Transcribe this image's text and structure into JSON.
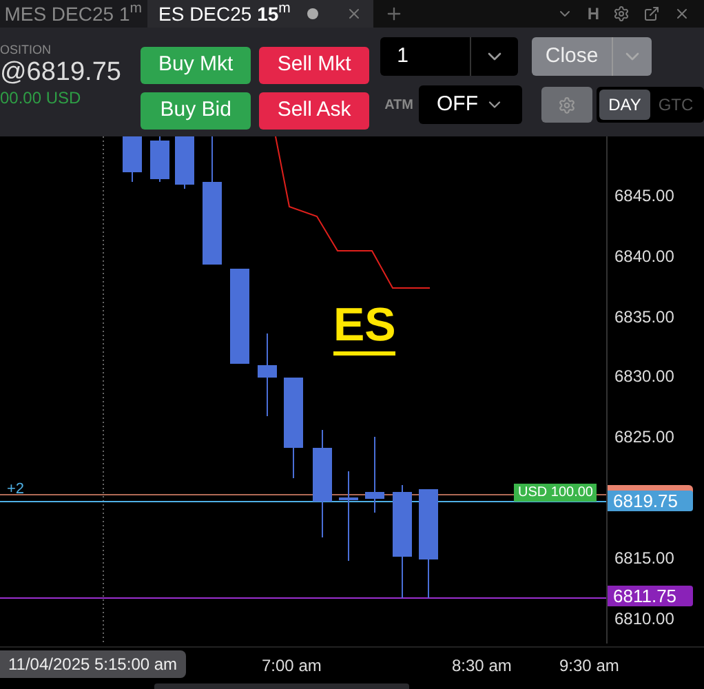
{
  "tabs": [
    {
      "label": "MES DEC25 1$^{m}$",
      "selected": false,
      "dot": false
    },
    {
      "label": "ES DEC25 **15**$^{m}$",
      "selected": true,
      "dot": true
    }
  ],
  "toolbar": {
    "h_label": "H"
  },
  "position": {
    "label": "OSITION",
    "price": "@6819.75",
    "pnl": "00.00 USD"
  },
  "order_buttons": [
    {
      "label": "Buy Mkt",
      "kind": "buy"
    },
    {
      "label": "Sell Mkt",
      "kind": "sell"
    },
    {
      "label": "Buy Bid",
      "kind": "buy"
    },
    {
      "label": "Sell Ask",
      "kind": "sell"
    }
  ],
  "quantity": {
    "value": "1"
  },
  "close_button": {
    "label": "Close"
  },
  "atm": {
    "label": "ATM",
    "value": "OFF"
  },
  "tif": [
    {
      "label": "DAY",
      "selected": true
    },
    {
      "label": "GTC",
      "selected": false
    }
  ],
  "chart": {
    "symbol": "ES",
    "position_marker": "+2",
    "pnl_tag": "USD 100.00",
    "price_ticks": [
      "6845.00",
      "6840.00",
      "6835.00",
      "6830.00",
      "6825.00",
      "6815.00",
      "6810.00"
    ],
    "price_tags": [
      {
        "label": "6819.75",
        "color": "#4a9fd8"
      },
      {
        "label": "6811.75",
        "color": "#8a22b8"
      }
    ],
    "time_ticks": [
      "7:00 am",
      "8:30 am",
      "9:30 am"
    ],
    "crosshair_time": "11/04/2025 5:15:00 am"
  }
}
